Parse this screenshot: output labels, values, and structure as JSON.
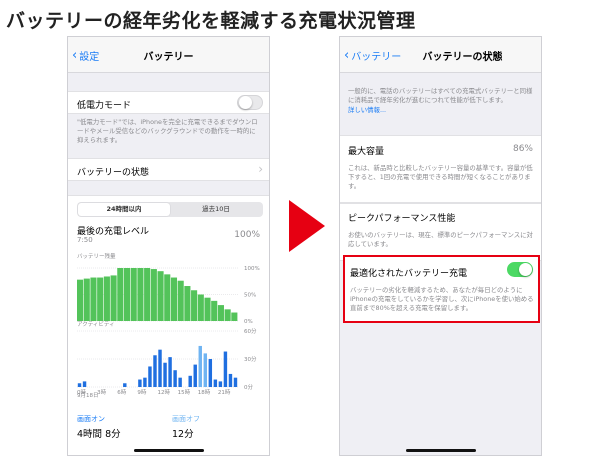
{
  "page_title": "バッテリーの経年劣化を軽減する充電状況管理",
  "colors": {
    "ios_blue": "#1a7cf5",
    "switch_on": "#4cd964",
    "arrow_red": "#e60012",
    "battery_green": "#53c35a",
    "activity_dark": "#1f6fe0",
    "activity_light": "#6fb4f2"
  },
  "left": {
    "nav": {
      "back_label": "設定",
      "title": "バッテリー"
    },
    "low_power": {
      "label": "低電力モード",
      "toggle": "off",
      "footnote": "\"低電力モード\"では、iPhoneを完全に充電できるまでダウンロードやメール受信などのバックグラウンドでの動作を一時的に抑えられます。"
    },
    "battery_health_row": {
      "label": "バッテリーの状態"
    },
    "tabs": {
      "tab1": "24時間以内",
      "tab2": "過去10日"
    },
    "last_charge": {
      "label": "最後の充電レベル",
      "time": "7:50",
      "value": "100%"
    },
    "battery_chart": {
      "title": "バッテリー残量",
      "ticks": [
        "100%",
        "50%",
        "0%"
      ]
    },
    "activity_chart": {
      "title": "アクティビティ",
      "ticks": [
        "60分",
        "30分",
        "0分"
      ],
      "x_labels": [
        "0時",
        "3時",
        "6時",
        "9時",
        "12時",
        "15時",
        "18時",
        "21時"
      ],
      "date_label": "9月18日"
    },
    "screen_on": {
      "label": "画面オン",
      "value": "4時間 8分"
    },
    "screen_off": {
      "label": "画面オフ",
      "value": "12分"
    }
  },
  "right": {
    "nav": {
      "back_label": "バッテリー",
      "title": "バッテリーの状態"
    },
    "intro": {
      "text": "一般的に、電話のバッテリーはすべての充電式バッテリーと同様に消耗品で経年劣化が進むにつれて性能が低下します。",
      "link": "詳しい情報..."
    },
    "max_capacity": {
      "label": "最大容量",
      "value": "86%",
      "footnote": "これは、新品時と比較したバッテリー容量の基準です。容量が低下すると、1回の充電で使用できる時間が短くなることがあります。"
    },
    "peak_performance": {
      "label": "ピークパフォーマンス性能",
      "footnote": "お使いのバッテリーは、現在、標準のピークパフォーマンスに対応しています。"
    },
    "optimized_charging": {
      "label": "最適化されたバッテリー充電",
      "toggle": "on",
      "footnote": "バッテリーの劣化を軽減するため、あなたが毎日どのようにiPhoneの充電をしているかを学習し、次にiPhoneを使い始める直前まで80%を超える充電を保留します。"
    }
  },
  "chart_data": [
    {
      "type": "area",
      "title": "バッテリー残量",
      "ylim": [
        0,
        100
      ],
      "y_ticks": [
        "100%",
        "50%",
        "0%"
      ],
      "x": [
        0,
        1,
        2,
        3,
        4,
        5,
        6,
        7,
        8,
        9,
        10,
        11,
        12,
        13,
        14,
        15,
        16,
        17,
        18,
        19,
        20,
        21,
        22,
        23
      ],
      "values": [
        78,
        80,
        82,
        82,
        84,
        86,
        100,
        100,
        100,
        100,
        100,
        98,
        94,
        88,
        82,
        76,
        66,
        58,
        50,
        44,
        38,
        30,
        22,
        16
      ]
    },
    {
      "type": "bar",
      "title": "アクティビティ",
      "ylim": [
        0,
        60
      ],
      "y_ticks": [
        "60分",
        "30分",
        "0分"
      ],
      "categories": [
        "0時",
        "3時",
        "6時",
        "9時",
        "12時",
        "15時",
        "18時",
        "21時"
      ],
      "series": [
        {
          "values": [
            4,
            6,
            0,
            0,
            0,
            0,
            0,
            0,
            0,
            4,
            0,
            0,
            8,
            10,
            22,
            34,
            40,
            26,
            32,
            18,
            10,
            0,
            12,
            24,
            44,
            36,
            30,
            8,
            6,
            38,
            14,
            10
          ]
        }
      ]
    }
  ]
}
